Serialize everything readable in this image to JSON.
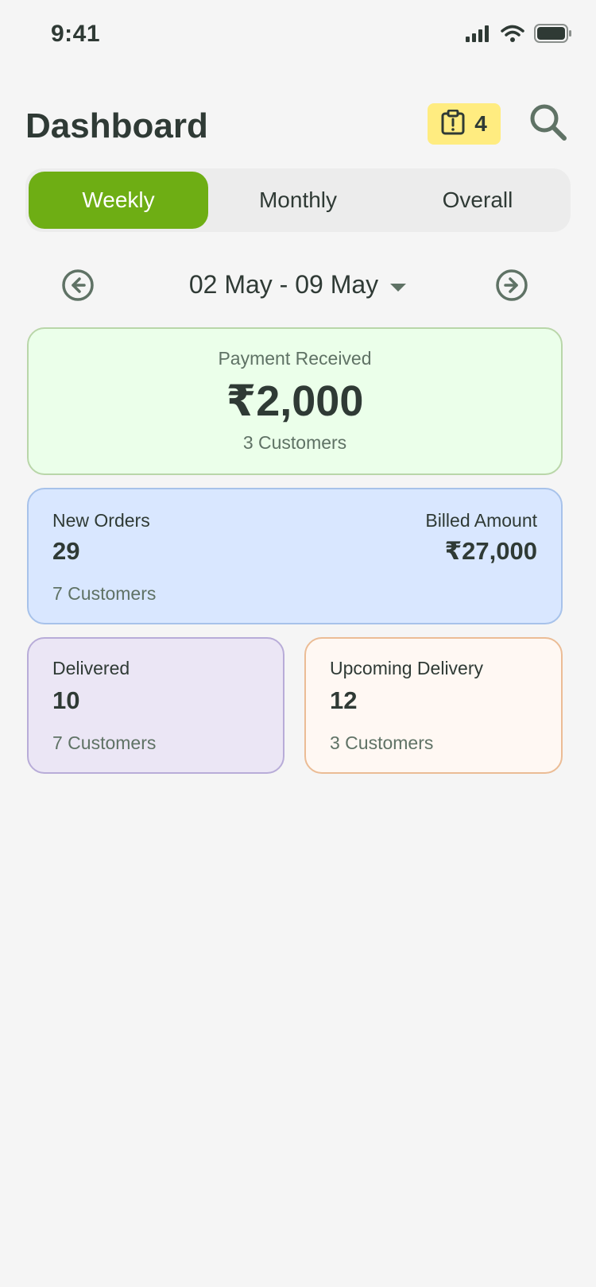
{
  "status_bar": {
    "time": "9:41",
    "icons": [
      "signal-icon",
      "wifi-icon",
      "battery-icon"
    ]
  },
  "header": {
    "title": "Dashboard",
    "alert_count": "4",
    "alert_icon": "clipboard-alert-icon",
    "search_icon": "search-icon"
  },
  "tabs": [
    {
      "label": "Weekly",
      "active": true
    },
    {
      "label": "Monthly",
      "active": false
    },
    {
      "label": "Overall",
      "active": false
    }
  ],
  "date_nav": {
    "range": "02 May - 09 May",
    "prev_icon": "arrow-left-circle-icon",
    "next_icon": "arrow-right-circle-icon",
    "dropdown_icon": "caret-down-icon"
  },
  "cards": {
    "payment": {
      "label": "Payment Received",
      "amount": "₹2,000",
      "customers": "3 Customers"
    },
    "orders": {
      "label": "New Orders",
      "value": "29",
      "customers": "7 Customers",
      "billed_label": "Billed Amount",
      "billed_value": "₹27,000"
    },
    "delivered": {
      "label": "Delivered",
      "value": "10",
      "customers": "7 Customers"
    },
    "upcoming": {
      "label": "Upcoming Delivery",
      "value": "12",
      "customers": "3 Customers"
    }
  },
  "colors": {
    "accent_green": "#6eae14",
    "alert_yellow": "#ffec80",
    "payment_bg": "#ebffea",
    "orders_bg": "#d9e7ff",
    "delivered_bg": "#ebe6f5",
    "upcoming_bg": "#fff8f3"
  }
}
